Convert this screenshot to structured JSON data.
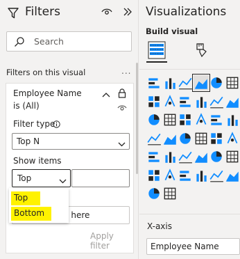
{
  "filters": {
    "title": "Filters",
    "search_placeholder": "Search",
    "section_label": "Filters on this visual",
    "more": "...",
    "card": {
      "field": "Employee Name",
      "state": "is (All)",
      "filter_type_label": "Filter type",
      "filter_type_value": "Top N",
      "show_items_label": "Show items",
      "show_items_value": "Top",
      "count_value": "",
      "by_value_text": "ls here",
      "apply_label": "Apply filter"
    },
    "dropdown_options": [
      "Top",
      "Bottom"
    ],
    "highlight_color": "#fff200"
  },
  "visualizations": {
    "title": "Visualizations",
    "build_visual_label": "Build visual",
    "x_axis_label": "X-axis",
    "x_axis_field": "Employee Name",
    "gallery_icons": [
      "stacked-bar-icon",
      "stacked-column-icon",
      "clustered-bar-icon",
      "clustered-column-icon",
      "stacked-bar-100-icon",
      "line-icon",
      "area-icon",
      "stacked-area-icon",
      "line-column-icon",
      "line-clustered-icon",
      "ribbon-icon",
      "waterfall-icon",
      "funnel-icon",
      "scatter-icon",
      "pie-icon",
      "donut-icon",
      "treemap-icon",
      "map-icon",
      "filled-map-icon",
      "azure-map-icon",
      "gauge-icon",
      "card-icon",
      "multirow-card-icon",
      "kpi-icon",
      "slicer-icon",
      "table-icon",
      "matrix-icon",
      "r-visual-icon",
      "python-icon",
      "key-influencers-icon",
      "decomposition-tree-icon",
      "qa-icon",
      "narrative-icon",
      "goals-icon",
      "paginated-icon",
      "power-apps-icon",
      "power-automate-icon",
      "more-visuals-icon"
    ],
    "accent_blue": "#118dff",
    "accent_dark": "#252423"
  }
}
